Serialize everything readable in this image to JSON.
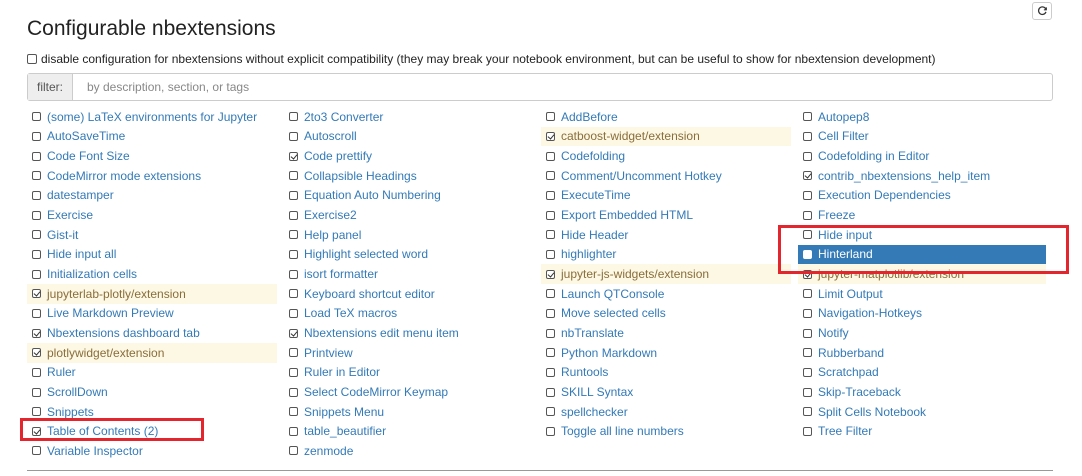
{
  "page": {
    "title": "Configurable nbextensions"
  },
  "compat": {
    "checked": false,
    "label": "disable configuration for nbextensions without explicit compatibility (they may break your notebook environment, but can be useful to show for nbextension development)"
  },
  "filter": {
    "label": "filter:",
    "placeholder": "by description, section, or tags",
    "value": ""
  },
  "columns": [
    [
      {
        "label": "(some) LaTeX environments for Jupyter",
        "checked": false
      },
      {
        "label": "AutoSaveTime",
        "checked": false
      },
      {
        "label": "Code Font Size",
        "checked": false
      },
      {
        "label": "CodeMirror mode extensions",
        "checked": false
      },
      {
        "label": "datestamper",
        "checked": false
      },
      {
        "label": "Exercise",
        "checked": false
      },
      {
        "label": "Gist-it",
        "checked": false
      },
      {
        "label": "Hide input all",
        "checked": false
      },
      {
        "label": "Initialization cells",
        "checked": false
      },
      {
        "label": "jupyterlab-plotly/extension",
        "checked": true,
        "warning": true
      },
      {
        "label": "Live Markdown Preview",
        "checked": false
      },
      {
        "label": "Nbextensions dashboard tab",
        "checked": true
      },
      {
        "label": "plotlywidget/extension",
        "checked": true,
        "warning": true
      },
      {
        "label": "Ruler",
        "checked": false
      },
      {
        "label": "ScrollDown",
        "checked": false
      },
      {
        "label": "Snippets",
        "checked": false
      },
      {
        "label": "Table of Contents (2)",
        "checked": true
      },
      {
        "label": "Variable Inspector",
        "checked": false
      }
    ],
    [
      {
        "label": "2to3 Converter",
        "checked": false
      },
      {
        "label": "Autoscroll",
        "checked": false
      },
      {
        "label": "Code prettify",
        "checked": true
      },
      {
        "label": "Collapsible Headings",
        "checked": false
      },
      {
        "label": "Equation Auto Numbering",
        "checked": false
      },
      {
        "label": "Exercise2",
        "checked": false
      },
      {
        "label": "Help panel",
        "checked": false
      },
      {
        "label": "Highlight selected word",
        "checked": false
      },
      {
        "label": "isort formatter",
        "checked": false
      },
      {
        "label": "Keyboard shortcut editor",
        "checked": false
      },
      {
        "label": "Load TeX macros",
        "checked": false
      },
      {
        "label": "Nbextensions edit menu item",
        "checked": true
      },
      {
        "label": "Printview",
        "checked": false
      },
      {
        "label": "Ruler in Editor",
        "checked": false
      },
      {
        "label": "Select CodeMirror Keymap",
        "checked": false
      },
      {
        "label": "Snippets Menu",
        "checked": false
      },
      {
        "label": "table_beautifier",
        "checked": false
      },
      {
        "label": "zenmode",
        "checked": false
      }
    ],
    [
      {
        "label": "AddBefore",
        "checked": false
      },
      {
        "label": "catboost-widget/extension",
        "checked": true,
        "warning": true
      },
      {
        "label": "Codefolding",
        "checked": false
      },
      {
        "label": "Comment/Uncomment Hotkey",
        "checked": false
      },
      {
        "label": "ExecuteTime",
        "checked": false
      },
      {
        "label": "Export Embedded HTML",
        "checked": false
      },
      {
        "label": "Hide Header",
        "checked": false
      },
      {
        "label": "highlighter",
        "checked": false
      },
      {
        "label": "jupyter-js-widgets/extension",
        "checked": true,
        "warning": true
      },
      {
        "label": "Launch QTConsole",
        "checked": false
      },
      {
        "label": "Move selected cells",
        "checked": false
      },
      {
        "label": "nbTranslate",
        "checked": false
      },
      {
        "label": "Python Markdown",
        "checked": false
      },
      {
        "label": "Runtools",
        "checked": false
      },
      {
        "label": "SKILL Syntax",
        "checked": false
      },
      {
        "label": "spellchecker",
        "checked": false
      },
      {
        "label": "Toggle all line numbers",
        "checked": false
      }
    ],
    [
      {
        "label": "Autopep8",
        "checked": false
      },
      {
        "label": "Cell Filter",
        "checked": false
      },
      {
        "label": "Codefolding in Editor",
        "checked": false
      },
      {
        "label": "contrib_nbextensions_help_item",
        "checked": true
      },
      {
        "label": "Execution Dependencies",
        "checked": false
      },
      {
        "label": "Freeze",
        "checked": false
      },
      {
        "label": "Hide input",
        "checked": false
      },
      {
        "label": "Hinterland",
        "checked": true,
        "selected": true
      },
      {
        "label": "jupyter-matplotlib/extension",
        "checked": true,
        "warning": true
      },
      {
        "label": "Limit Output",
        "checked": false
      },
      {
        "label": "Navigation-Hotkeys",
        "checked": false
      },
      {
        "label": "Notify",
        "checked": false
      },
      {
        "label": "Rubberband",
        "checked": false
      },
      {
        "label": "Scratchpad",
        "checked": false
      },
      {
        "label": "Skip-Traceback",
        "checked": false
      },
      {
        "label": "Split Cells Notebook",
        "checked": false
      },
      {
        "label": "Tree Filter",
        "checked": false
      }
    ]
  ],
  "colors": {
    "link": "#337ab7",
    "warning_bg": "#fcf8e3",
    "selected_bg": "#337ab7",
    "annotation": "#e3262d"
  },
  "icons": {
    "refresh": "refresh-icon"
  }
}
